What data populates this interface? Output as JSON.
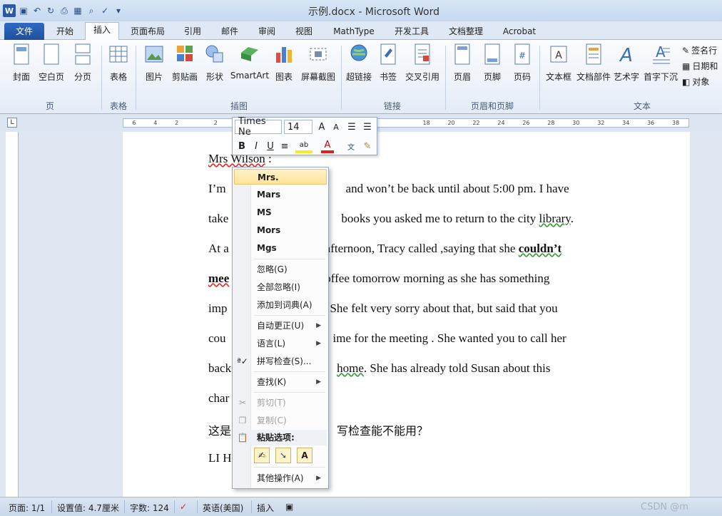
{
  "window": {
    "title": "示例.docx - Microsoft Word"
  },
  "tabs": [
    "文件",
    "开始",
    "插入",
    "页面布局",
    "引用",
    "邮件",
    "审阅",
    "视图",
    "MathType",
    "开发工具",
    "文档整理",
    "Acrobat"
  ],
  "ribbon": {
    "buttons": [
      "封面",
      "空白页",
      "分页",
      "表格",
      "图片",
      "剪贴画",
      "形状",
      "SmartArt",
      "图表",
      "屏幕截图",
      "超链接",
      "书签",
      "交叉引用",
      "页眉",
      "页脚",
      "页码",
      "文本框",
      "文档部件",
      "艺术字",
      "首字下沉"
    ],
    "groups": [
      "页",
      "表格",
      "插图",
      "链接",
      "页眉和页脚",
      "文本"
    ],
    "right_items": [
      "签名行",
      "日期和",
      "对象"
    ]
  },
  "ruler": {
    "ticks": [
      "6",
      "4",
      "2",
      "",
      "2",
      "4",
      "6",
      "8",
      "",
      "",
      "",
      "",
      "",
      "",
      "",
      "18",
      "20",
      "22",
      "24",
      "26",
      "28",
      "30",
      "32",
      "34",
      "36",
      "38"
    ]
  },
  "document": {
    "line1_prefix": "Mrs Wilson",
    "line1_suffix": ":",
    "line2a": "I’m",
    "line2b": "and won’t be back until about 5:00 pm. I have",
    "line3a": "take",
    "line3b": "books you asked me to return to the city",
    "line3c": "library",
    "line4a": "At a",
    "line4b": "s afternoon",
    "line4c": "Tracy called ,saying that she",
    "line4d": "couldn’t",
    "line5a": "mee",
    "line5b": "offee tomorrow morning as she has something",
    "line6a": "imp",
    "line6b": "She felt very sorry about that",
    "line6c": "but said that you",
    "line7a": "cou",
    "line7b": "ime for the meeting .",
    "line7c": "She wanted you to call her",
    "line8a": "back",
    "line8b": "home",
    "line8c": "She has already told Susan about this",
    "line9a": "char",
    "line10a": "这是",
    "line10b": "写检查能不能用？",
    "line11a": "LI H"
  },
  "mini_toolbar": {
    "font": "Times Ne",
    "size": "14"
  },
  "context_menu": {
    "suggestions": [
      "Mrs.",
      "Mars",
      "MS",
      "Mors",
      "Mgs"
    ],
    "items": {
      "ignore": "忽略(G)",
      "ignore_all": "全部忽略(I)",
      "add_dict": "添加到词典(A)",
      "autocorrect": "自动更正(U)",
      "language": "语言(L)",
      "spell": "拼写检查(S)...",
      "find": "查找(K)",
      "cut": "剪切(T)",
      "copy": "复制(C)",
      "paste_opts": "粘贴选项:",
      "more": "其他操作(A)"
    }
  },
  "statusbar": {
    "page": "页面: 1/1",
    "setting": "设置值: 4.7厘米",
    "words": "字数: 124",
    "lang": "英语(美国)",
    "mode": "插入"
  },
  "watermark": "CSDN @m"
}
